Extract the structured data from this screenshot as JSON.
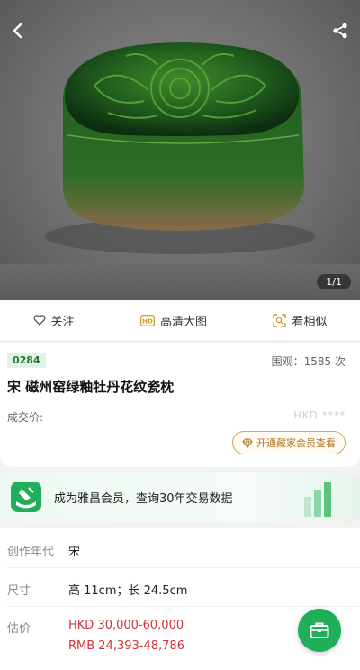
{
  "hero": {
    "pager": "1/1"
  },
  "actions": [
    {
      "label": "关注",
      "icon": "heart-icon"
    },
    {
      "label": "高清大图",
      "icon": "hd-icon"
    },
    {
      "label": "看相似",
      "icon": "scan-icon"
    }
  ],
  "lot": {
    "number": "0284",
    "views": "围观：1585 次",
    "title": "宋 磁州窑绿釉牡丹花纹瓷枕",
    "price_label": "成交价:",
    "price_hidden": "HKD ****",
    "member_button": "开通藏家会员查看"
  },
  "banner": {
    "text": "成为雅昌会员，查询30年交易数据"
  },
  "details": {
    "era_label": "创作年代",
    "era": "宋",
    "size_label": "尺寸",
    "size": "高 11cm；长 24.5cm",
    "estimate_label": "估价",
    "estimate_hkd": "HKD  30,000-60,000",
    "estimate_rmb": "RMB 24,393-48,786"
  },
  "colors": {
    "accent": "#1fae5a",
    "estimate": "#d0343a",
    "gold": "#b07a2a"
  }
}
